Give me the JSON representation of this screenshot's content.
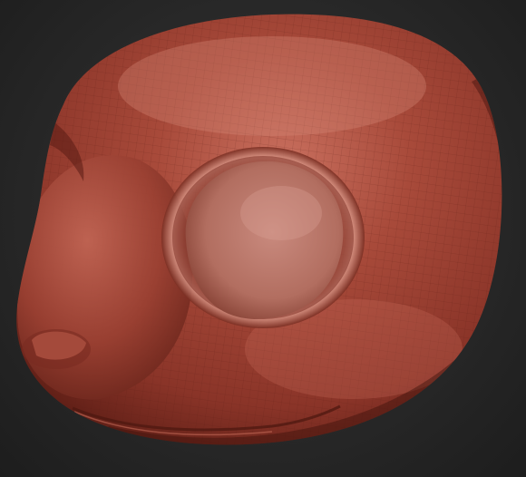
{
  "viewport": {
    "background_color": "#2a2a2a"
  },
  "model": {
    "material_color": "#a84a3a",
    "shadow_color": "#5a1c14",
    "highlight_color": "#d88a78",
    "wireframe_visible": true
  }
}
